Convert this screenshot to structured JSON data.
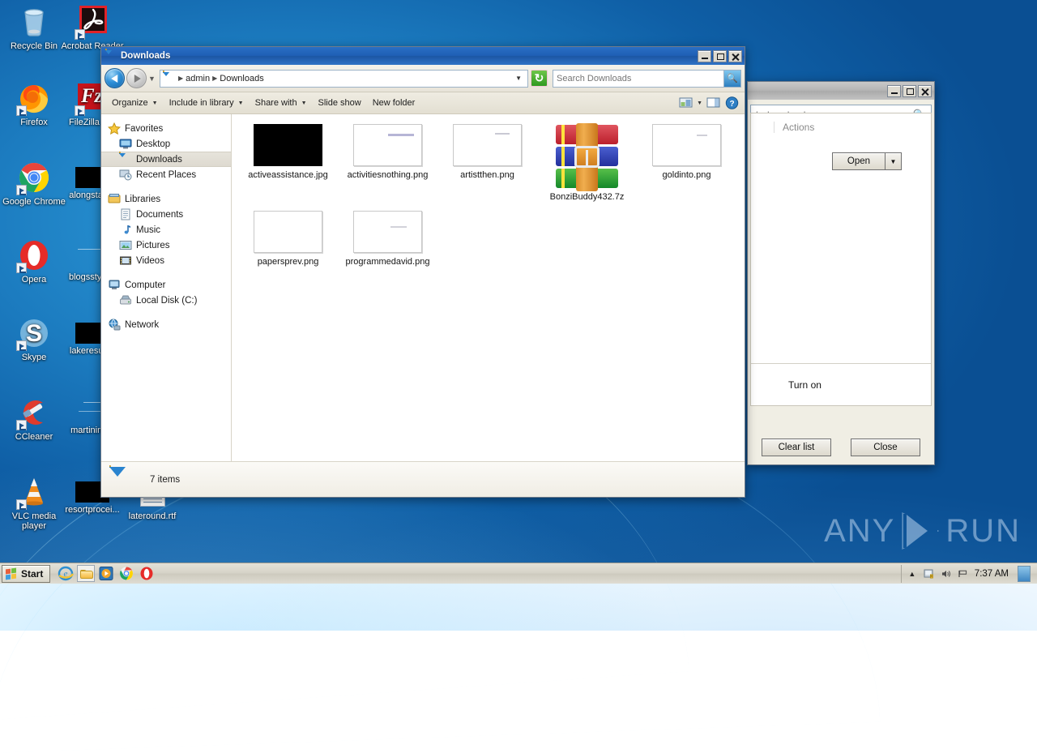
{
  "desktop": {
    "icons": [
      {
        "name": "Recycle Bin",
        "icon": "recycle-bin-icon",
        "type": "system"
      },
      {
        "name": "Acrobat Reader",
        "icon": "acrobat-reader-icon",
        "type": "shortcut"
      },
      {
        "name": "Firefox",
        "icon": "firefox-icon",
        "type": "shortcut"
      },
      {
        "name": "FileZilla C...",
        "icon": "filezilla-icon",
        "type": "shortcut"
      },
      {
        "name": "Google Chrome",
        "icon": "chrome-icon",
        "type": "shortcut"
      },
      {
        "name": "alongstart...",
        "icon": "black-thumbnail-icon",
        "type": "file"
      },
      {
        "name": "Opera",
        "icon": "opera-icon",
        "type": "shortcut"
      },
      {
        "name": "blogsstyle...",
        "icon": "white-thumbnail-icon",
        "type": "file"
      },
      {
        "name": "Skype",
        "icon": "skype-icon",
        "type": "shortcut"
      },
      {
        "name": "lakeresult...",
        "icon": "black-thumbnail-icon",
        "type": "file"
      },
      {
        "name": "CCleaner",
        "icon": "ccleaner-icon",
        "type": "shortcut"
      },
      {
        "name": "martinins...",
        "icon": "white-thumbnail-icon",
        "type": "file"
      },
      {
        "name": "VLC media player",
        "icon": "vlc-icon",
        "type": "shortcut"
      },
      {
        "name": "resortprocei...",
        "icon": "black-thumbnail-icon",
        "type": "file"
      },
      {
        "name": "lateround.rtf",
        "icon": "rtf-document-icon",
        "type": "file"
      }
    ]
  },
  "explorer": {
    "title": "Downloads",
    "title_icon": "downloads-folder-icon",
    "window_buttons": {
      "minimize": "_",
      "maximize": "□",
      "close": "✕"
    },
    "nav": {
      "back_label": "Back",
      "forward_label": "Forward",
      "history_label": "Recent pages",
      "address_icon": "downloads-folder-icon",
      "breadcrumbs": [
        "admin",
        "Downloads"
      ],
      "address_dropdown": "▼",
      "refresh_label": "Refresh"
    },
    "search": {
      "value": "Search Downloads",
      "placeholder": "Search Downloads",
      "button_icon": "search-icon"
    },
    "toolbar": [
      {
        "label": "Organize",
        "has_caret": true
      },
      {
        "label": "Include in library",
        "has_caret": true
      },
      {
        "label": "Share with",
        "has_caret": true
      },
      {
        "label": "Slide show",
        "has_caret": false
      },
      {
        "label": "New folder",
        "has_caret": false
      }
    ],
    "toolbar_right": [
      {
        "name": "change-view-icon",
        "caret": true
      },
      {
        "name": "preview-pane-icon",
        "caret": false
      },
      {
        "name": "help-icon",
        "caret": false
      }
    ],
    "navpane": [
      {
        "label": "Favorites",
        "icon": "star-icon",
        "indent": false,
        "selected": false
      },
      {
        "label": "Desktop",
        "icon": "desktop-icon",
        "indent": true,
        "selected": false
      },
      {
        "label": "Downloads",
        "icon": "downloads-folder-icon",
        "indent": true,
        "selected": true
      },
      {
        "label": "Recent Places",
        "icon": "recent-places-icon",
        "indent": true,
        "selected": false
      },
      {
        "gap": true
      },
      {
        "label": "Libraries",
        "icon": "libraries-icon",
        "indent": false,
        "selected": false
      },
      {
        "label": "Documents",
        "icon": "documents-library-icon",
        "indent": true,
        "selected": false
      },
      {
        "label": "Music",
        "icon": "music-library-icon",
        "indent": true,
        "selected": false
      },
      {
        "label": "Pictures",
        "icon": "pictures-library-icon",
        "indent": true,
        "selected": false
      },
      {
        "label": "Videos",
        "icon": "videos-library-icon",
        "indent": true,
        "selected": false
      },
      {
        "gap": true
      },
      {
        "label": "Computer",
        "icon": "computer-icon",
        "indent": false,
        "selected": false
      },
      {
        "label": "Local Disk (C:)",
        "icon": "hard-disk-icon",
        "indent": true,
        "selected": false
      },
      {
        "gap": true
      },
      {
        "label": "Network",
        "icon": "network-icon",
        "indent": false,
        "selected": false
      }
    ],
    "files": [
      {
        "name": "activeassistance.jpg",
        "thumb": "black"
      },
      {
        "name": "activitiesnothing.png",
        "thumb": "white-faint-text"
      },
      {
        "name": "artistthen.png",
        "thumb": "white-faint-text"
      },
      {
        "name": "BonziBuddy432.7z",
        "thumb": "archive"
      },
      {
        "name": "goldinto.png",
        "thumb": "white-faint-text"
      },
      {
        "name": "papersprev.png",
        "thumb": "white-blank"
      },
      {
        "name": "programmedavid.png",
        "thumb": "white-faint-text"
      }
    ],
    "status": {
      "icon": "downloads-folder-icon",
      "text": "7 items"
    }
  },
  "downloads_window": {
    "title": "",
    "window_buttons": {
      "minimize": "_",
      "maximize": "□",
      "close": "✕"
    },
    "search": {
      "value": "h downloads",
      "placeholder": "Search downloads",
      "icon": "search-icon"
    },
    "actions_label": "Actions",
    "open_button": "Open",
    "open_dropdown": "▼",
    "turn_on_label": "Turn on",
    "clear_list_button": "Clear list",
    "close_button": "Close"
  },
  "taskbar": {
    "start_label": "Start",
    "quick_launch": [
      {
        "name": "internet-explorer-icon"
      },
      {
        "name": "windows-explorer-icon",
        "active": true
      },
      {
        "name": "media-player-icon"
      },
      {
        "name": "chrome-icon"
      },
      {
        "name": "opera-icon"
      }
    ],
    "tray": [
      {
        "name": "show-hidden-icons-icon",
        "glyph": "▲"
      },
      {
        "name": "action-center-icon"
      },
      {
        "name": "volume-icon"
      },
      {
        "name": "network-icon"
      }
    ],
    "clock": "7:37 AM",
    "show_desktop_label": "Show desktop"
  },
  "watermark": {
    "left": "ANY",
    "right": "RUN"
  },
  "colors": {
    "title_active": "#1f5fb5",
    "title_inactive": "#b4b4b4",
    "chrome": "#f0eee4",
    "selection": "#dedad0",
    "desktop_blue": "#1278bd"
  }
}
